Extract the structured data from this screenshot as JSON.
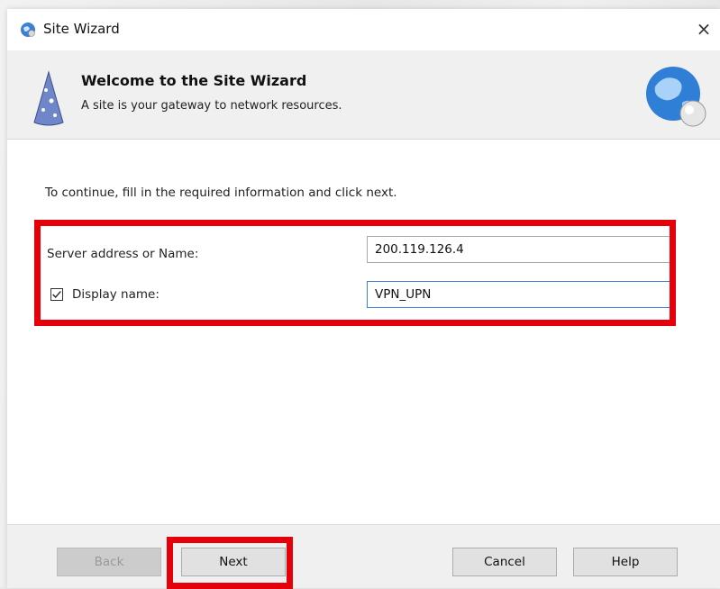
{
  "window": {
    "title": "Site Wizard",
    "close_glyph": "×"
  },
  "banner": {
    "title": "Welcome to the Site Wizard",
    "subtitle": "A site is your gateway to network resources."
  },
  "main": {
    "instructions": "To continue, fill in the required information and click next.",
    "server": {
      "label": "Server address or Name:",
      "value": "200.119.126.4"
    },
    "display": {
      "label": "Display name:",
      "value": "VPN_UPN",
      "checked": true
    }
  },
  "footer": {
    "back": "Back",
    "next": "Next",
    "cancel": "Cancel",
    "help": "Help"
  },
  "colors": {
    "highlight": "#e5000a",
    "focus_border": "#3b82d6"
  },
  "icons": [
    "app-globe-icon",
    "close-icon",
    "wizard-hat-icon",
    "globe-icon",
    "checkmark-icon"
  ]
}
